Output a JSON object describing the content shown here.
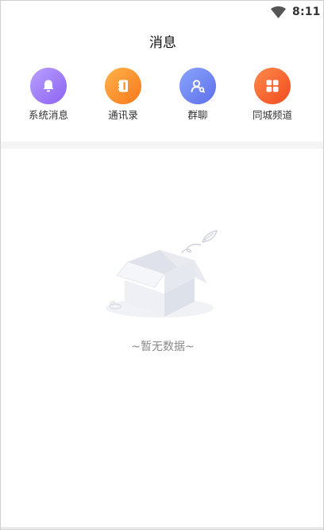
{
  "status_bar": {
    "time": "8:11",
    "icon": "wifi-icon"
  },
  "header": {
    "title": "消息"
  },
  "quick_actions": [
    {
      "label": "系统消息",
      "icon": "bell-icon",
      "color": "#9a74f6"
    },
    {
      "label": "通讯录",
      "icon": "contact-book-icon",
      "color": "#f98b25"
    },
    {
      "label": "群聊",
      "icon": "group-chat-icon",
      "color": "#6b7ff0"
    },
    {
      "label": "同城频道",
      "icon": "grid-icon",
      "color": "#f4592a"
    }
  ],
  "empty_state": {
    "icon": "empty-box-icon",
    "text": "~暂无数据~"
  }
}
